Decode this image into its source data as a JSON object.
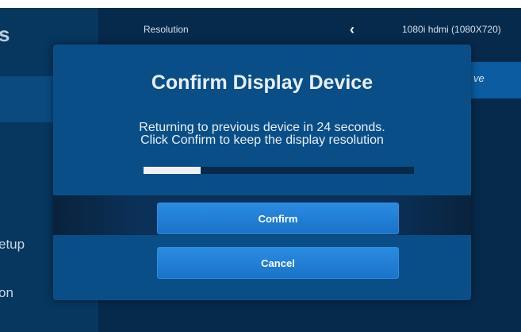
{
  "sidebar": {
    "title_fragment": "s",
    "items": [
      {
        "label": "etup"
      },
      {
        "label": "on"
      }
    ]
  },
  "settings": {
    "resolution_label": "Resolution",
    "resolution_value": "1080i hdmi (1080X720)",
    "action_label": "ve"
  },
  "modal": {
    "title": "Confirm Display Device",
    "message_line1": "Returning to previous device in 24 seconds.",
    "message_line2": "Click Confirm to keep the display resolution",
    "progress_fraction": 0.21,
    "confirm_label": "Confirm",
    "cancel_label": "Cancel"
  },
  "colors": {
    "background": "#062a4c",
    "modal": "#0a4e88",
    "button": "#1e7fd6",
    "progress_fill": "#f0f0f0"
  },
  "icons": {
    "resolution_prev": "chevron-left-icon"
  }
}
